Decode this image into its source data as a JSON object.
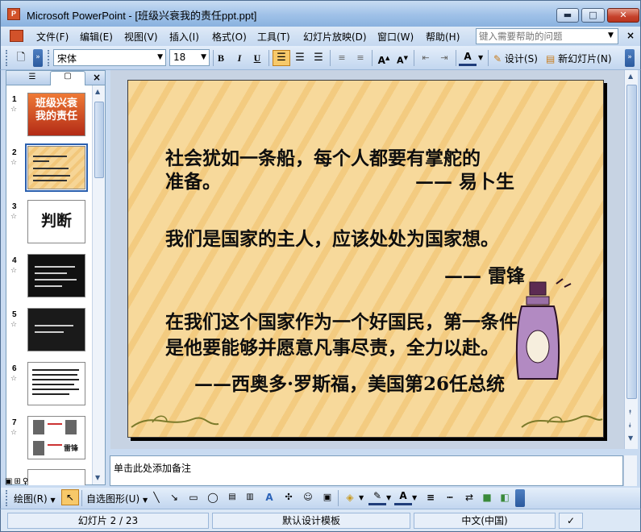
{
  "window": {
    "app_icon": "P",
    "title": "Microsoft PowerPoint - [班级兴衰我的责任ppt.ppt]",
    "minimize_icon": "minimize-icon",
    "maximize_icon": "maximize-icon",
    "close_icon": "close-icon"
  },
  "menu": {
    "items": [
      "文件(F)",
      "编辑(E)",
      "视图(V)",
      "插入(I)",
      "格式(O)",
      "工具(T)",
      "幻灯片放映(D)",
      "窗口(W)",
      "帮助(H)"
    ],
    "help_placeholder": "键入需要帮助的问题"
  },
  "format_toolbar": {
    "font_name": "宋体",
    "font_size": "18",
    "bold": "B",
    "italic": "I",
    "underline": "U",
    "design_label": "设计(S)",
    "new_slide_label": "新幻灯片(N)",
    "font_color": "A"
  },
  "slides_pane": {
    "tab_outline_icon": "outline-tab-icon",
    "tab_slides_icon": "slides-tab-icon",
    "close": "×",
    "thumbnails": [
      {
        "number": "1",
        "text": "班级兴衰\n我的责任"
      },
      {
        "number": "2",
        "text": ""
      },
      {
        "number": "3",
        "text": "判断"
      },
      {
        "number": "4",
        "text": ""
      },
      {
        "number": "5",
        "text": ""
      },
      {
        "number": "6",
        "text": ""
      },
      {
        "number": "7",
        "text": "雷锋"
      }
    ],
    "selected": 2
  },
  "slide": {
    "lines": [
      "社会犹如一条船，每个人都要有掌舵的",
      "准备。",
      "—— 易卜生",
      "我们是国家的主人，应该处处为国家想。",
      "—— 雷锋",
      "在我们这个国家作为一个好国民，第一条件",
      "是他要能够并愿意凡事尽责，全力以赴。",
      "——西奥多·罗斯福，美国第26任总统"
    ],
    "background_colors": {
      "light": "#f7d99b",
      "stripe": "#f3cb80"
    }
  },
  "notes": {
    "placeholder": "单击此处添加备注"
  },
  "drawing_toolbar": {
    "draw_label": "绘图(R)",
    "autoshapes_label": "自选图形(U)"
  },
  "status": {
    "slide_indicator": "幻灯片 2 / 23",
    "template": "默认设计模板",
    "language": "中文(中国)"
  }
}
